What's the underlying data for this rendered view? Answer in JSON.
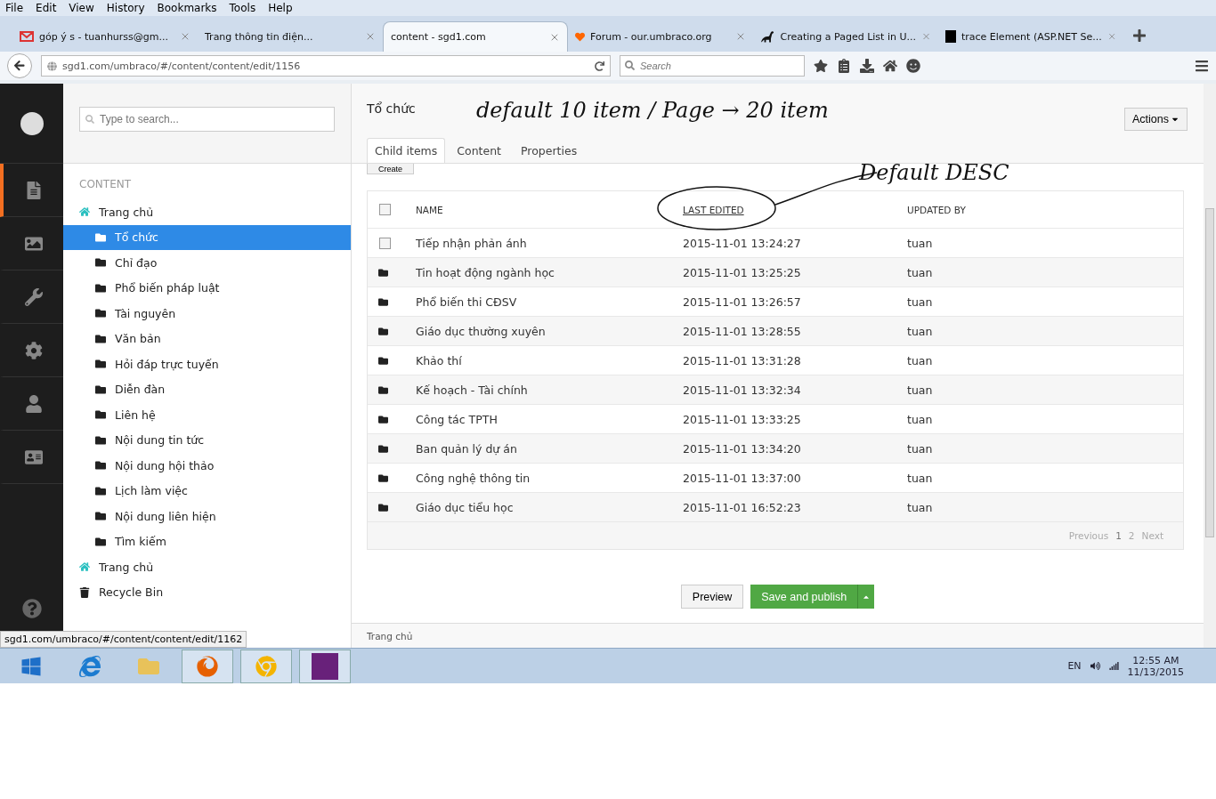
{
  "menu": [
    "File",
    "Edit",
    "View",
    "History",
    "Bookmarks",
    "Tools",
    "Help"
  ],
  "browser_tabs": [
    {
      "label": "góp ý s - tuanhurss@gm...",
      "selected": false,
      "kind": "mail"
    },
    {
      "label": "Trang thông tin điện...",
      "selected": false,
      "kind": "plain"
    },
    {
      "label": "content - sgd1.com",
      "selected": true,
      "kind": "plain"
    },
    {
      "label": "Forum - our.umbraco.org",
      "selected": false,
      "kind": "heart"
    },
    {
      "label": "Creating a Paged List in U...",
      "selected": false,
      "kind": "dino"
    },
    {
      "label": "trace Element (ASP.NET Se...",
      "selected": false,
      "kind": "m"
    }
  ],
  "address": {
    "value": "sgd1.com/umbraco/#/content/content/edit/1156"
  },
  "browser_search": {
    "placeholder": "Search"
  },
  "sidebar_nav": [
    {
      "kind": "content",
      "selected": true
    },
    {
      "kind": "media",
      "selected": false
    },
    {
      "kind": "developer",
      "selected": false
    },
    {
      "kind": "settings",
      "selected": false
    },
    {
      "kind": "users",
      "selected": false
    },
    {
      "kind": "members",
      "selected": false
    }
  ],
  "tree_search": {
    "placeholder": "Type to search..."
  },
  "tree_heading": "CONTENT",
  "tree": [
    {
      "label": "Trang chủ",
      "kind": "home",
      "selected": false,
      "children": [
        {
          "label": "Tổ chức",
          "kind": "folder",
          "selected": true
        },
        {
          "label": "Chỉ đạo",
          "kind": "folder",
          "selected": false
        },
        {
          "label": "Phổ biến pháp luật",
          "kind": "folder",
          "selected": false
        },
        {
          "label": "Tài nguyên",
          "kind": "folder",
          "selected": false
        },
        {
          "label": "Văn bản",
          "kind": "folder",
          "selected": false
        },
        {
          "label": "Hỏi đáp trực tuyến",
          "kind": "folder",
          "selected": false
        },
        {
          "label": "Diễn đàn",
          "kind": "folder",
          "selected": false
        },
        {
          "label": "Liên hệ",
          "kind": "folder",
          "selected": false
        },
        {
          "label": "Nội dung tin tức",
          "kind": "folder",
          "selected": false
        },
        {
          "label": "Nội dung hội thảo",
          "kind": "folder",
          "selected": false
        },
        {
          "label": "Lịch làm việc",
          "kind": "folder",
          "selected": false
        },
        {
          "label": "Nội dung liên hiện",
          "kind": "folder",
          "selected": false
        },
        {
          "label": "Tìm kiếm",
          "kind": "folder",
          "selected": false
        }
      ]
    },
    {
      "label": "Trang chủ",
      "kind": "home",
      "selected": false
    },
    {
      "label": "Recycle Bin",
      "kind": "bin",
      "selected": false
    }
  ],
  "editor": {
    "title": "Tổ chức",
    "tabs": [
      {
        "label": "Child items",
        "selected": true
      },
      {
        "label": "Content",
        "selected": false
      },
      {
        "label": "Properties",
        "selected": false
      }
    ],
    "actions": "Actions",
    "create": "Create"
  },
  "annotations": [
    "default 10 item / Page → 20 item",
    "Default DESC"
  ],
  "table": {
    "columns": [
      {
        "label": "NAME",
        "sorted": false
      },
      {
        "label": "LAST EDITED",
        "sorted": true
      },
      {
        "label": "UPDATED BY",
        "sorted": false
      }
    ],
    "select_all_checked": false,
    "rows": [
      {
        "name": "Tiếp nhận phản ánh",
        "edited": "2015-11-01 13:24:27",
        "by": "tuan",
        "kind": "checkbox",
        "checked": false
      },
      {
        "name": "Tin hoạt động ngành học",
        "edited": "2015-11-01 13:25:25",
        "by": "tuan",
        "kind": "folder"
      },
      {
        "name": "Phổ biến thi CĐSV",
        "edited": "2015-11-01 13:26:57",
        "by": "tuan",
        "kind": "folder"
      },
      {
        "name": "Giáo dục thường xuyên",
        "edited": "2015-11-01 13:28:55",
        "by": "tuan",
        "kind": "folder"
      },
      {
        "name": "Khảo thí",
        "edited": "2015-11-01 13:31:28",
        "by": "tuan",
        "kind": "folder"
      },
      {
        "name": "Kế hoạch - Tài chính",
        "edited": "2015-11-01 13:32:34",
        "by": "tuan",
        "kind": "folder"
      },
      {
        "name": "Công tác TPTH",
        "edited": "2015-11-01 13:33:25",
        "by": "tuan",
        "kind": "folder"
      },
      {
        "name": "Ban quản lý dự án",
        "edited": "2015-11-01 13:34:20",
        "by": "tuan",
        "kind": "folder"
      },
      {
        "name": "Công nghệ thông tin",
        "edited": "2015-11-01 13:37:00",
        "by": "tuan",
        "kind": "folder"
      },
      {
        "name": "Giáo dục tiểu học",
        "edited": "2015-11-01 16:52:23",
        "by": "tuan",
        "kind": "folder"
      }
    ],
    "pagination": [
      {
        "label": "Previous",
        "selected": false
      },
      {
        "label": "1",
        "selected": true
      },
      {
        "label": "2",
        "selected": false
      },
      {
        "label": "Next",
        "selected": false
      }
    ]
  },
  "buttons": {
    "preview": "Preview",
    "publish": "Save and publish"
  },
  "breadcrumb": "Trang chủ",
  "status_url": "sgd1.com/umbraco/#/content/content/edit/1162",
  "taskbar": {
    "language": "EN",
    "time": "12:55 AM",
    "date": "11/13/2015"
  }
}
